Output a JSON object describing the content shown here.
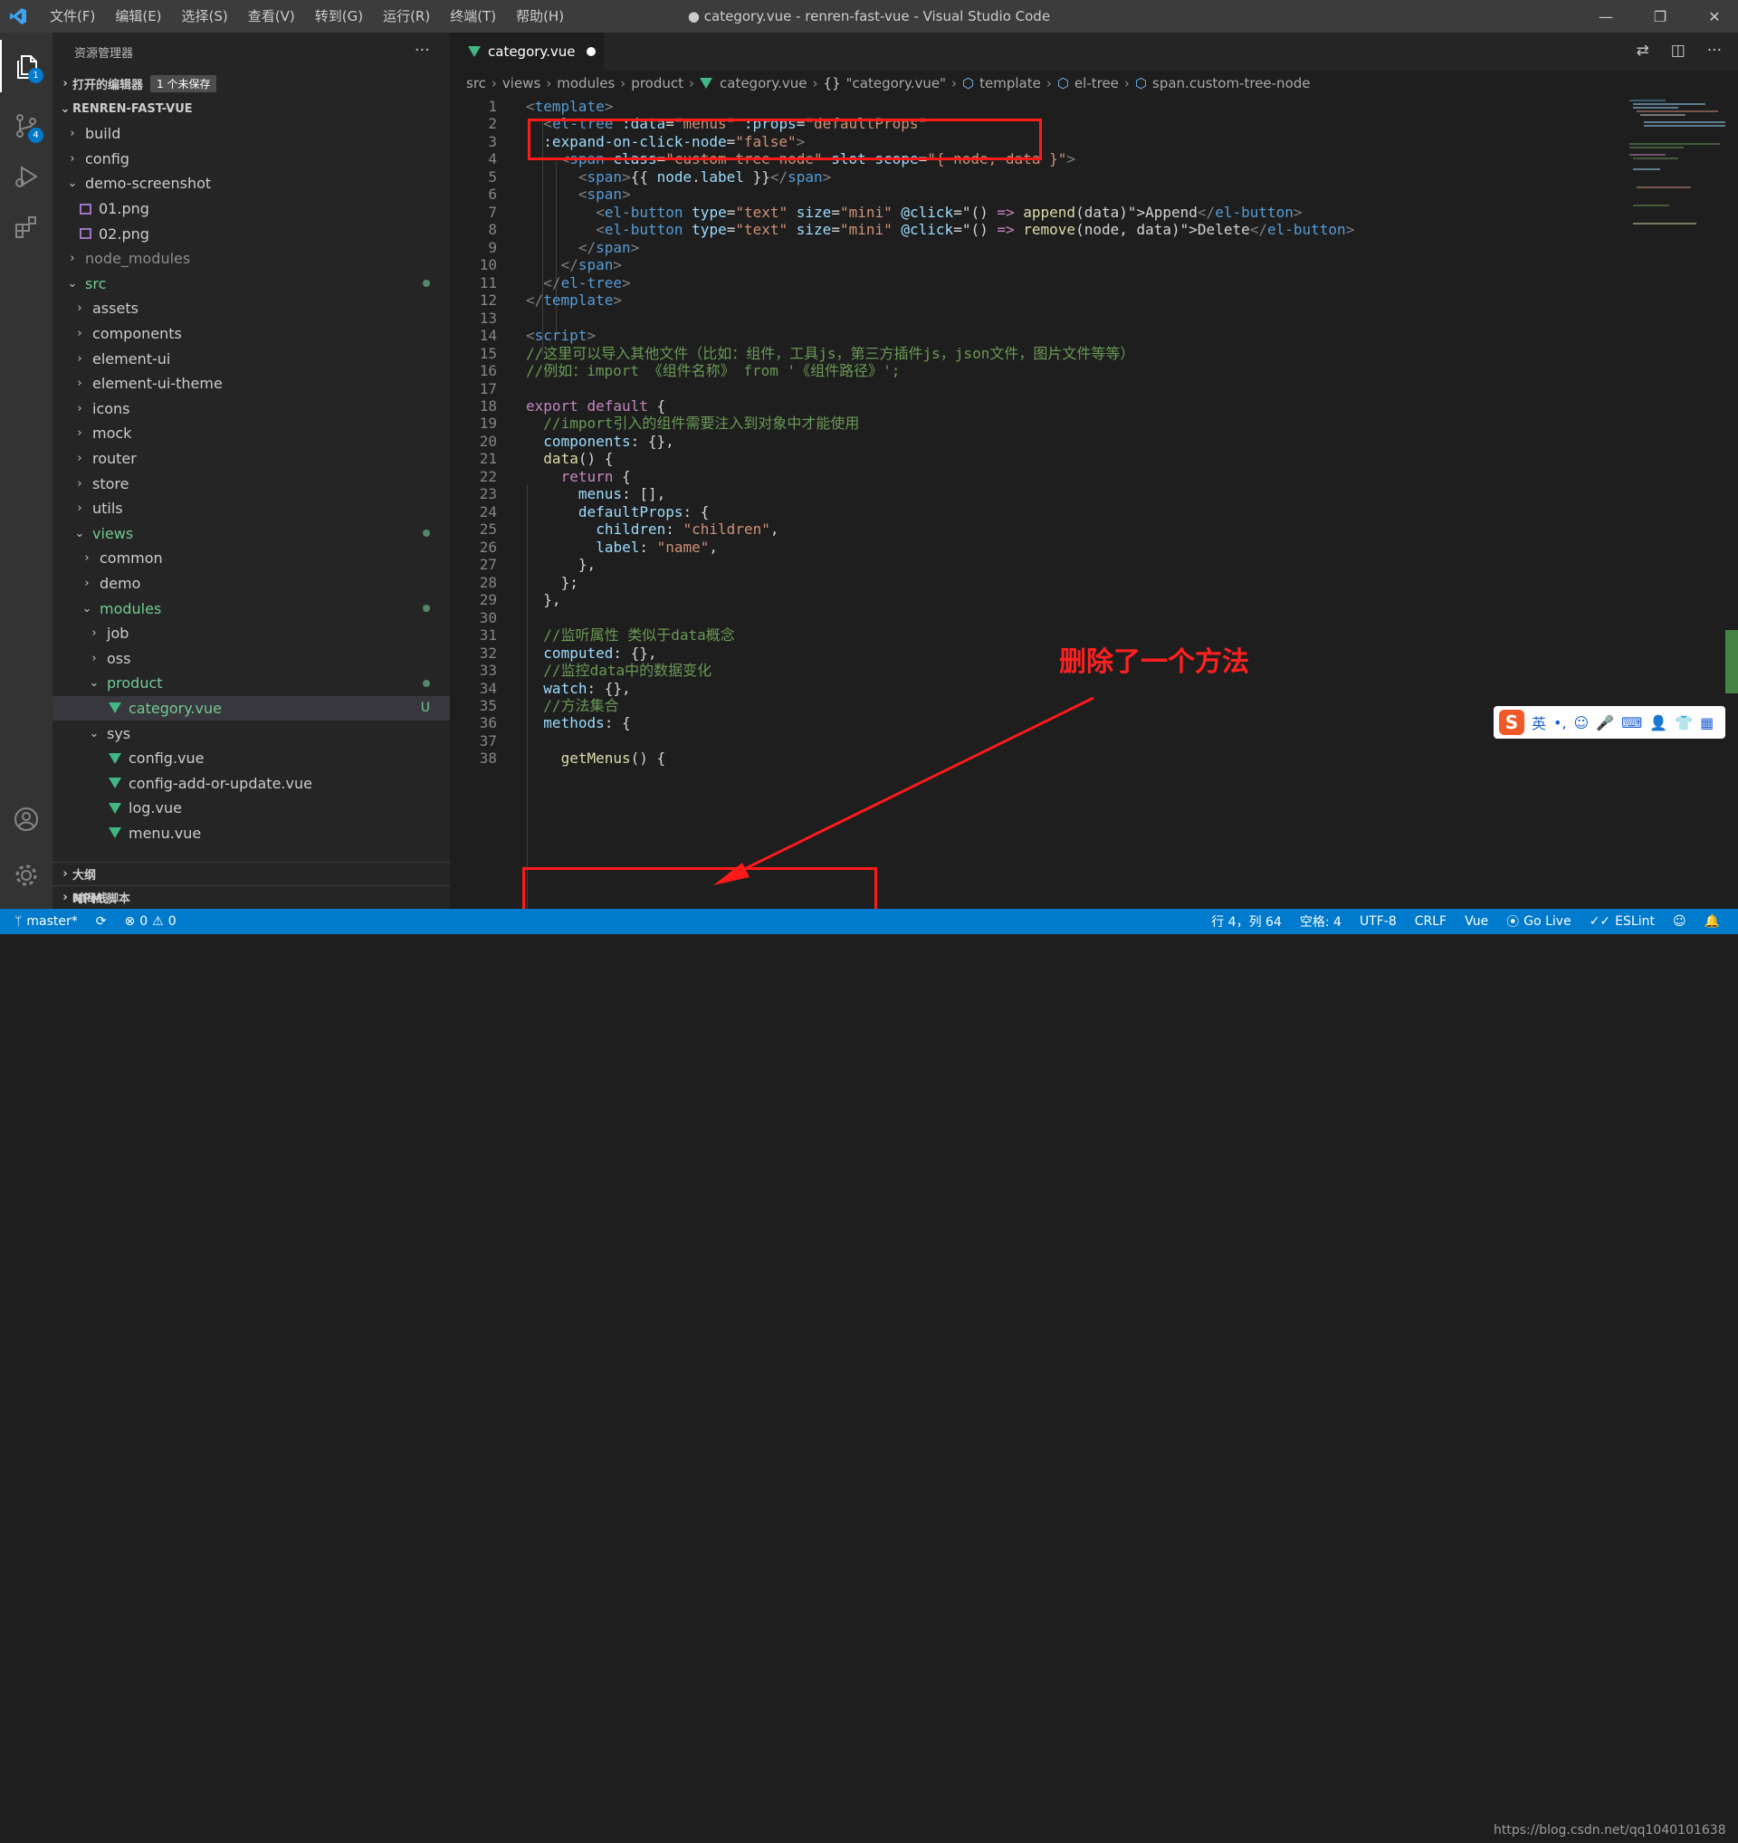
{
  "window": {
    "title": "● category.vue - renren-fast-vue - Visual Studio Code",
    "menu": [
      "文件(F)",
      "编辑(E)",
      "选择(S)",
      "查看(V)",
      "转到(G)",
      "运行(R)",
      "终端(T)",
      "帮助(H)"
    ]
  },
  "activity": {
    "explorer_badge": "1",
    "scm_badge": "4"
  },
  "sidebar": {
    "header": "资源管理器",
    "open_editors": "打开的编辑器",
    "unsaved": "1 个未保存",
    "project": "RENREN-FAST-VUE",
    "tree": [
      {
        "label": "build",
        "depth": 1,
        "type": "folder",
        "open": false
      },
      {
        "label": "config",
        "depth": 1,
        "type": "folder",
        "open": false
      },
      {
        "label": "demo-screenshot",
        "depth": 1,
        "type": "folder",
        "open": true
      },
      {
        "label": "01.png",
        "depth": 1,
        "type": "png"
      },
      {
        "label": "02.png",
        "depth": 1,
        "type": "png"
      },
      {
        "label": "node_modules",
        "depth": 1,
        "type": "folder",
        "open": false,
        "dim": true
      },
      {
        "label": "src",
        "depth": 1,
        "type": "folder",
        "open": true,
        "green": true,
        "dot": true
      },
      {
        "label": "assets",
        "depth": 2,
        "type": "folder",
        "open": false
      },
      {
        "label": "components",
        "depth": 2,
        "type": "folder",
        "open": false
      },
      {
        "label": "element-ui",
        "depth": 2,
        "type": "folder",
        "open": false
      },
      {
        "label": "element-ui-theme",
        "depth": 2,
        "type": "folder",
        "open": false
      },
      {
        "label": "icons",
        "depth": 2,
        "type": "folder",
        "open": false
      },
      {
        "label": "mock",
        "depth": 2,
        "type": "folder",
        "open": false
      },
      {
        "label": "router",
        "depth": 2,
        "type": "folder",
        "open": false
      },
      {
        "label": "store",
        "depth": 2,
        "type": "folder",
        "open": false
      },
      {
        "label": "utils",
        "depth": 2,
        "type": "folder",
        "open": false
      },
      {
        "label": "views",
        "depth": 2,
        "type": "folder",
        "open": true,
        "green": true,
        "dot": true
      },
      {
        "label": "common",
        "depth": 3,
        "type": "folder",
        "open": false
      },
      {
        "label": "demo",
        "depth": 3,
        "type": "folder",
        "open": false
      },
      {
        "label": "modules",
        "depth": 3,
        "type": "folder",
        "open": true,
        "green": true,
        "dot": true
      },
      {
        "label": "job",
        "depth": 4,
        "type": "folder",
        "open": false
      },
      {
        "label": "oss",
        "depth": 4,
        "type": "folder",
        "open": false
      },
      {
        "label": "product",
        "depth": 4,
        "type": "folder",
        "open": true,
        "green": true,
        "dot": true
      },
      {
        "label": "category.vue",
        "depth": 5,
        "type": "vue",
        "green": true,
        "active": true,
        "mark": "U"
      },
      {
        "label": "sys",
        "depth": 4,
        "type": "folder",
        "open": true
      },
      {
        "label": "config.vue",
        "depth": 5,
        "type": "vue"
      },
      {
        "label": "config-add-or-update.vue",
        "depth": 5,
        "type": "vue"
      },
      {
        "label": "log.vue",
        "depth": 5,
        "type": "vue"
      },
      {
        "label": "menu.vue",
        "depth": 5,
        "type": "vue"
      }
    ],
    "outline": "大纲",
    "timeline": "时间线",
    "npm": "NPM 脚本"
  },
  "editor": {
    "tab_label": "category.vue",
    "breadcrumb": [
      "src",
      "views",
      "modules",
      "product",
      "category.vue",
      "\"category.vue\"",
      "template",
      "el-tree",
      "span.custom-tree-node"
    ],
    "lines": [
      {
        "n": "1",
        "i": 0,
        "p": [
          [
            "b",
            "<"
          ],
          [
            "t",
            "template"
          ],
          [
            "b",
            ">"
          ]
        ]
      },
      {
        "n": "2",
        "i": 1,
        "p": [
          [
            "b",
            "<"
          ],
          [
            "t",
            "el-tree"
          ],
          [
            "x",
            " "
          ],
          [
            "a",
            ":data"
          ],
          [
            "x",
            "="
          ],
          [
            "s",
            "\"menus\""
          ],
          [
            "x",
            " "
          ],
          [
            "a",
            ":props"
          ],
          [
            "x",
            "="
          ],
          [
            "s",
            "\"defaultProps\""
          ]
        ]
      },
      {
        "n": "3",
        "i": 1,
        "p": [
          [
            "a",
            ":expand-on-click-node"
          ],
          [
            "x",
            "="
          ],
          [
            "s",
            "\"false\""
          ],
          [
            "b",
            ">"
          ]
        ]
      },
      {
        "n": "4",
        "i": 2,
        "p": [
          [
            "b",
            "<"
          ],
          [
            "t",
            "span"
          ],
          [
            "x",
            " "
          ],
          [
            "a",
            "class"
          ],
          [
            "x",
            "="
          ],
          [
            "s",
            "\"custom-tree-node\""
          ],
          [
            "x",
            " "
          ],
          [
            "a",
            "slot-scope"
          ],
          [
            "x",
            "="
          ],
          [
            "s",
            "\"{ node, data }\""
          ],
          [
            "b",
            ">"
          ]
        ]
      },
      {
        "n": "5",
        "i": 3,
        "p": [
          [
            "b",
            "<"
          ],
          [
            "t",
            "span"
          ],
          [
            "b",
            ">"
          ],
          [
            "x",
            "{{ "
          ],
          [
            "a",
            "node"
          ],
          [
            "x",
            "."
          ],
          [
            "a",
            "label"
          ],
          [
            "x",
            " }}"
          ],
          [
            "b",
            "</"
          ],
          [
            "t",
            "span"
          ],
          [
            "b",
            ">"
          ]
        ]
      },
      {
        "n": "6",
        "i": 3,
        "p": [
          [
            "b",
            "<"
          ],
          [
            "t",
            "span"
          ],
          [
            "b",
            ">"
          ]
        ]
      },
      {
        "n": "7",
        "i": 4,
        "p": [
          [
            "b",
            "<"
          ],
          [
            "t",
            "el-button"
          ],
          [
            "x",
            " "
          ],
          [
            "a",
            "type"
          ],
          [
            "x",
            "="
          ],
          [
            "s",
            "\"text\""
          ],
          [
            "x",
            " "
          ],
          [
            "a",
            "size"
          ],
          [
            "x",
            "="
          ],
          [
            "s",
            "\"mini\""
          ],
          [
            "x",
            " "
          ],
          [
            "a",
            "@click"
          ],
          [
            "x",
            "=\"() "
          ],
          [
            "k",
            "=>"
          ],
          [
            "x",
            " "
          ],
          [
            "f",
            "append"
          ],
          [
            "x",
            "(data)\">Append"
          ],
          [
            "b",
            "</"
          ],
          [
            "t",
            "el-button"
          ],
          [
            "b",
            ">"
          ]
        ]
      },
      {
        "n": "8",
        "i": 4,
        "p": [
          [
            "b",
            "<"
          ],
          [
            "t",
            "el-button"
          ],
          [
            "x",
            " "
          ],
          [
            "a",
            "type"
          ],
          [
            "x",
            "="
          ],
          [
            "s",
            "\"text\""
          ],
          [
            "x",
            " "
          ],
          [
            "a",
            "size"
          ],
          [
            "x",
            "="
          ],
          [
            "s",
            "\"mini\""
          ],
          [
            "x",
            " "
          ],
          [
            "a",
            "@click"
          ],
          [
            "x",
            "=\"() "
          ],
          [
            "k",
            "=>"
          ],
          [
            "x",
            " "
          ],
          [
            "f",
            "remove"
          ],
          [
            "x",
            "(node, data)\">Delete"
          ],
          [
            "b",
            "</"
          ],
          [
            "t",
            "el-button"
          ],
          [
            "b",
            ">"
          ]
        ]
      },
      {
        "n": "9",
        "i": 3,
        "p": [
          [
            "b",
            "</"
          ],
          [
            "t",
            "span"
          ],
          [
            "b",
            ">"
          ]
        ]
      },
      {
        "n": "10",
        "i": 2,
        "p": [
          [
            "b",
            "</"
          ],
          [
            "t",
            "span"
          ],
          [
            "b",
            ">"
          ]
        ]
      },
      {
        "n": "11",
        "i": 1,
        "p": [
          [
            "b",
            "</"
          ],
          [
            "t",
            "el-tree"
          ],
          [
            "b",
            ">"
          ]
        ]
      },
      {
        "n": "12",
        "i": 0,
        "p": [
          [
            "b",
            "</"
          ],
          [
            "t",
            "template"
          ],
          [
            "b",
            ">"
          ]
        ]
      },
      {
        "n": "13",
        "i": 0,
        "p": []
      },
      {
        "n": "14",
        "i": 0,
        "p": [
          [
            "b",
            "<"
          ],
          [
            "t",
            "script"
          ],
          [
            "b",
            ">"
          ]
        ]
      },
      {
        "n": "15",
        "i": 0,
        "p": [
          [
            "c",
            "//这里可以导入其他文件（比如：组件，工具js，第三方插件js，json文件，图片文件等等）"
          ]
        ]
      },
      {
        "n": "16",
        "i": 0,
        "p": [
          [
            "c",
            "//例如：import 《组件名称》 from '《组件路径》';"
          ]
        ]
      },
      {
        "n": "17",
        "i": 0,
        "p": []
      },
      {
        "n": "18",
        "i": 0,
        "p": [
          [
            "k",
            "export"
          ],
          [
            "x",
            " "
          ],
          [
            "k",
            "default"
          ],
          [
            "x",
            " {"
          ]
        ]
      },
      {
        "n": "19",
        "i": 1,
        "p": [
          [
            "c",
            "//import引入的组件需要注入到对象中才能使用"
          ]
        ]
      },
      {
        "n": "20",
        "i": 1,
        "p": [
          [
            "a",
            "components"
          ],
          [
            "x",
            ": {},"
          ]
        ]
      },
      {
        "n": "21",
        "i": 1,
        "p": [
          [
            "f",
            "data"
          ],
          [
            "x",
            "() {"
          ]
        ]
      },
      {
        "n": "22",
        "i": 2,
        "p": [
          [
            "k",
            "return"
          ],
          [
            "x",
            " {"
          ]
        ]
      },
      {
        "n": "23",
        "i": 3,
        "p": [
          [
            "a",
            "menus"
          ],
          [
            "x",
            ": [],"
          ]
        ]
      },
      {
        "n": "24",
        "i": 3,
        "p": [
          [
            "a",
            "defaultProps"
          ],
          [
            "x",
            ": {"
          ]
        ]
      },
      {
        "n": "25",
        "i": 4,
        "p": [
          [
            "a",
            "children"
          ],
          [
            "x",
            ": "
          ],
          [
            "s",
            "\"children\""
          ],
          [
            "x",
            ","
          ]
        ]
      },
      {
        "n": "26",
        "i": 4,
        "p": [
          [
            "a",
            "label"
          ],
          [
            "x",
            ": "
          ],
          [
            "s",
            "\"name\""
          ],
          [
            "x",
            ","
          ]
        ]
      },
      {
        "n": "27",
        "i": 3,
        "p": [
          [
            "x",
            "},"
          ]
        ]
      },
      {
        "n": "28",
        "i": 2,
        "p": [
          [
            "x",
            "};"
          ]
        ]
      },
      {
        "n": "29",
        "i": 1,
        "p": [
          [
            "x",
            "},"
          ]
        ]
      },
      {
        "n": "30",
        "i": 0,
        "p": []
      },
      {
        "n": "31",
        "i": 1,
        "p": [
          [
            "c",
            "//监听属性 类似于data概念"
          ]
        ]
      },
      {
        "n": "32",
        "i": 1,
        "p": [
          [
            "a",
            "computed"
          ],
          [
            "x",
            ": {},"
          ]
        ]
      },
      {
        "n": "33",
        "i": 1,
        "p": [
          [
            "c",
            "//监控data中的数据变化"
          ]
        ]
      },
      {
        "n": "34",
        "i": 1,
        "p": [
          [
            "a",
            "watch"
          ],
          [
            "x",
            ": {},"
          ]
        ]
      },
      {
        "n": "35",
        "i": 1,
        "p": [
          [
            "c",
            "//方法集合"
          ]
        ]
      },
      {
        "n": "36",
        "i": 1,
        "p": [
          [
            "a",
            "methods"
          ],
          [
            "x",
            ": {"
          ]
        ]
      },
      {
        "n": "37",
        "i": 0,
        "p": []
      },
      {
        "n": "38",
        "i": 2,
        "p": [
          [
            "f",
            "getMenus"
          ],
          [
            "x",
            "() {"
          ]
        ]
      }
    ]
  },
  "annotation": {
    "text": "删除了一个方法"
  },
  "ime": {
    "label": "英"
  },
  "status": {
    "branch": "master*",
    "errors": "0",
    "warnings": "0",
    "position": "行 4，列 64",
    "spaces": "空格: 4",
    "encoding": "UTF-8",
    "eol": "CRLF",
    "language": "Vue",
    "golive": "Go Live",
    "eslint": "ESLint",
    "watermark": "https://blog.csdn.net/qq1040101638"
  }
}
